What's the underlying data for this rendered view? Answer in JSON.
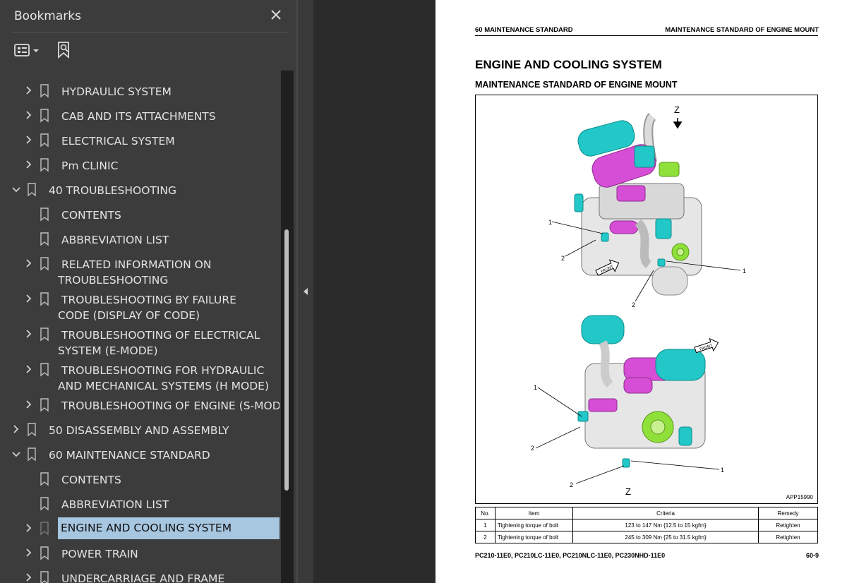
{
  "bookmarks_panel": {
    "title": "Bookmarks",
    "items": [
      {
        "label": "HYDRAULIC SYSTEM",
        "level": 1,
        "expander": "collapsed"
      },
      {
        "label": "CAB AND ITS ATTACHMENTS",
        "level": 1,
        "expander": "collapsed"
      },
      {
        "label": "ELECTRICAL SYSTEM",
        "level": 1,
        "expander": "collapsed"
      },
      {
        "label": "Pm CLINIC",
        "level": 1,
        "expander": "collapsed"
      },
      {
        "label": "40 TROUBLESHOOTING",
        "level": 0,
        "expander": "expanded"
      },
      {
        "label": "CONTENTS",
        "level": 1,
        "expander": "none"
      },
      {
        "label": "ABBREVIATION LIST",
        "level": 1,
        "expander": "none"
      },
      {
        "label": "RELATED INFORMATION ON TROUBLESHOOTING",
        "level": 1,
        "expander": "collapsed"
      },
      {
        "label": "TROUBLESHOOTING BY FAILURE CODE (DISPLAY OF CODE)",
        "level": 1,
        "expander": "collapsed"
      },
      {
        "label": "TROUBLESHOOTING OF ELECTRICAL SYSTEM (E-MODE)",
        "level": 1,
        "expander": "collapsed"
      },
      {
        "label": "TROUBLESHOOTING FOR HYDRAULIC AND MECHANICAL SYSTEMS (H MODE)",
        "level": 1,
        "expander": "collapsed"
      },
      {
        "label": "TROUBLESHOOTING OF ENGINE (S-MODE)",
        "level": 1,
        "expander": "collapsed"
      },
      {
        "label": "50 DISASSEMBLY AND ASSEMBLY",
        "level": 0,
        "expander": "collapsed"
      },
      {
        "label": "60 MAINTENANCE STANDARD",
        "level": 0,
        "expander": "expanded"
      },
      {
        "label": "CONTENTS",
        "level": 1,
        "expander": "none"
      },
      {
        "label": "ABBREVIATION LIST",
        "level": 1,
        "expander": "none"
      },
      {
        "label": "ENGINE AND COOLING SYSTEM",
        "level": 1,
        "expander": "collapsed",
        "selected": true
      },
      {
        "label": "POWER TRAIN",
        "level": 1,
        "expander": "collapsed"
      },
      {
        "label": "UNDERCARRIAGE AND FRAME",
        "level": 1,
        "expander": "collapsed"
      }
    ]
  },
  "page": {
    "running_head_left": "60 MAINTENANCE STANDARD",
    "running_head_right": "MAINTENANCE STANDARD OF ENGINE MOUNT",
    "heading": "ENGINE AND COOLING SYSTEM",
    "subheading": "MAINTENANCE STANDARD OF ENGINE MOUNT",
    "figure": {
      "id": "APP15990",
      "callouts": [
        "1",
        "2",
        "1",
        "2",
        "1",
        "2",
        "1",
        "2"
      ],
      "view_label_top": "Z",
      "view_label_bottom": "Z",
      "front_label": "FRONT"
    },
    "table": {
      "headers": [
        "No.",
        "Item",
        "Criteria",
        "Remedy"
      ],
      "rows": [
        [
          "1",
          "Tightening torque of bolt",
          "123 to 147 Nm {12.5 to 15 kgfm}",
          "Retighten"
        ],
        [
          "2",
          "Tightening torque of bolt",
          "245 to 309 Nm {25 to 31.5 kgfm}",
          "Retighten"
        ]
      ]
    },
    "footer_left": "PC210-11E0, PC210LC-11E0, PC210NLC-11E0, PC230NHD-11E0",
    "footer_right": "60-9"
  },
  "colors": {
    "panel_bg": "#3c3c3c",
    "selection_bg": "#a7c6e0",
    "viewer_bg": "#2b2b2b",
    "engine_cyan": "#22c7c7",
    "engine_magenta": "#d64ed6",
    "engine_green": "#8fe03a"
  }
}
